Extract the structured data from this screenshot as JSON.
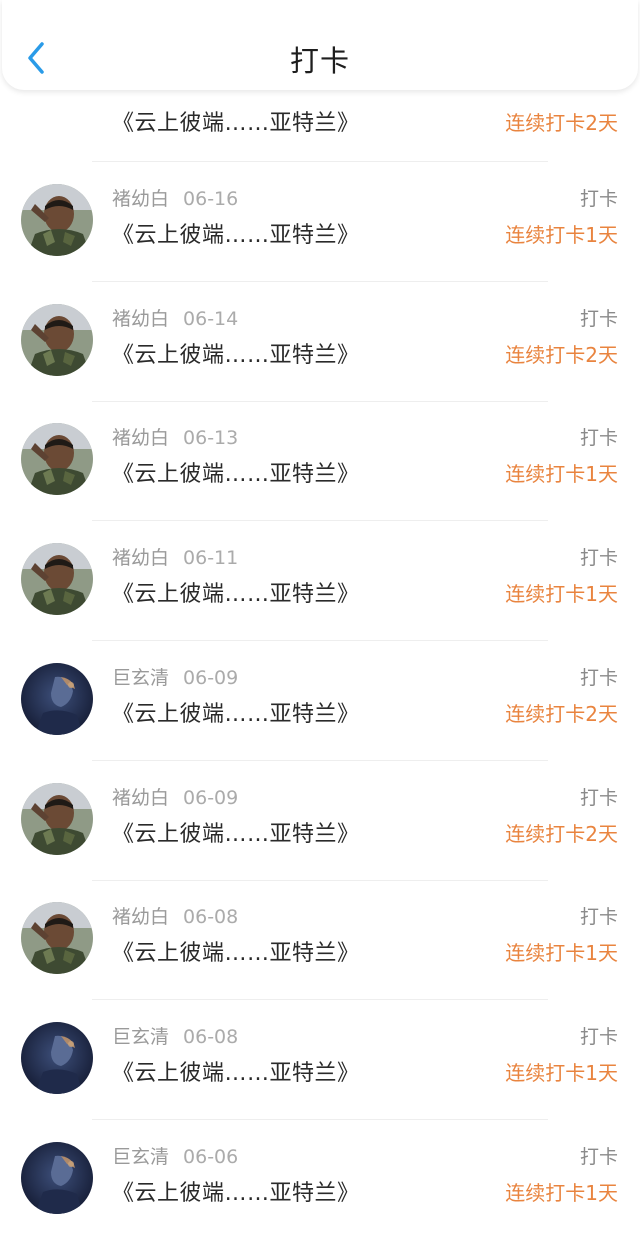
{
  "header": {
    "title": "打卡",
    "back_icon": "chevron-left-icon",
    "accent_color": "#2a9be8"
  },
  "colors": {
    "streak": "#e9843f",
    "name": "#9a9a9a",
    "title": "#2a2a2a"
  },
  "entries": [
    {
      "avatar": "soldier-avatar",
      "name": "",
      "date": "",
      "action": "",
      "book_title": "《云上彼端……亚特兰》",
      "streak": "连续打卡2天"
    },
    {
      "avatar": "soldier-avatar",
      "name": "褚幼白",
      "date": "06-16",
      "action": "打卡",
      "book_title": "《云上彼端……亚特兰》",
      "streak": "连续打卡1天"
    },
    {
      "avatar": "soldier-avatar",
      "name": "褚幼白",
      "date": "06-14",
      "action": "打卡",
      "book_title": "《云上彼端……亚特兰》",
      "streak": "连续打卡2天"
    },
    {
      "avatar": "soldier-avatar",
      "name": "褚幼白",
      "date": "06-13",
      "action": "打卡",
      "book_title": "《云上彼端……亚特兰》",
      "streak": "连续打卡1天"
    },
    {
      "avatar": "soldier-avatar",
      "name": "褚幼白",
      "date": "06-11",
      "action": "打卡",
      "book_title": "《云上彼端……亚特兰》",
      "streak": "连续打卡1天"
    },
    {
      "avatar": "night-portrait-avatar",
      "name": "巨玄清",
      "date": "06-09",
      "action": "打卡",
      "book_title": "《云上彼端……亚特兰》",
      "streak": "连续打卡2天"
    },
    {
      "avatar": "soldier-avatar",
      "name": "褚幼白",
      "date": "06-09",
      "action": "打卡",
      "book_title": "《云上彼端……亚特兰》",
      "streak": "连续打卡2天"
    },
    {
      "avatar": "soldier-avatar",
      "name": "褚幼白",
      "date": "06-08",
      "action": "打卡",
      "book_title": "《云上彼端……亚特兰》",
      "streak": "连续打卡1天"
    },
    {
      "avatar": "night-portrait-avatar",
      "name": "巨玄清",
      "date": "06-08",
      "action": "打卡",
      "book_title": "《云上彼端……亚特兰》",
      "streak": "连续打卡1天"
    },
    {
      "avatar": "night-portrait-avatar",
      "name": "巨玄清",
      "date": "06-06",
      "action": "打卡",
      "book_title": "《云上彼端……亚特兰》",
      "streak": "连续打卡1天"
    }
  ]
}
